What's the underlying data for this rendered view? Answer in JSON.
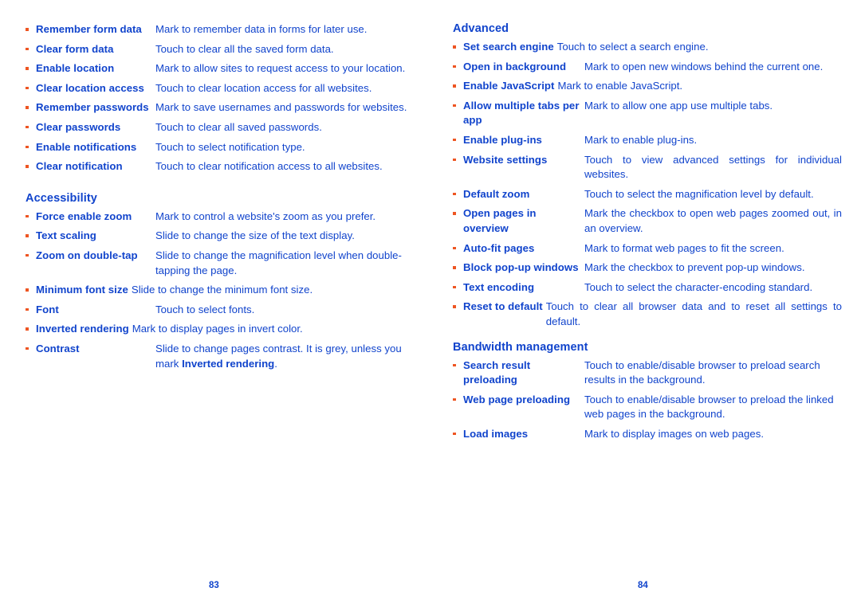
{
  "colors": {
    "text": "#1144cc",
    "bullet": "#ee5522",
    "background": "#ffffff"
  },
  "left_page": {
    "page_number": "83",
    "top_rows": [
      {
        "term": "Remember form data",
        "desc": "Mark to remember data in forms for later use."
      },
      {
        "term": "Clear form data",
        "desc": "Touch to clear all the saved form data."
      },
      {
        "term": "Enable location",
        "desc": "Mark to allow sites to request access to your location."
      },
      {
        "term": "Clear location access",
        "desc": "Touch to clear location access for all websites."
      },
      {
        "term": "Remember passwords",
        "desc": "Mark to save usernames and passwords for websites."
      },
      {
        "term": "Clear passwords",
        "desc": "Touch to clear all saved passwords."
      },
      {
        "term": "Enable notifications",
        "desc": "Touch to select notification type."
      },
      {
        "term": "Clear notification",
        "desc": "Touch to clear notification access to all websites."
      }
    ],
    "accessibility": {
      "heading": "Accessibility",
      "rows": [
        {
          "term": "Force enable zoom",
          "desc": "Mark to control a website's zoom as you prefer."
        },
        {
          "term": "Text scaling",
          "desc": "Slide to change the size of the text display."
        },
        {
          "term": "Zoom on double-tap",
          "desc": "Slide to change the magnification level when double-tapping the page."
        },
        {
          "term": "Minimum font size",
          "desc": "Slide to change the minimum font size."
        },
        {
          "term": "Font",
          "desc": "Touch to select fonts."
        },
        {
          "term": "Inverted rendering",
          "desc": "Mark to display pages in invert color."
        },
        {
          "term": "Contrast",
          "desc_prefix": "Slide to change pages contrast. It is grey, unless you mark ",
          "desc_bold": "Inverted rendering",
          "desc_suffix": "."
        }
      ]
    }
  },
  "right_page": {
    "page_number": "84",
    "advanced": {
      "heading": "Advanced",
      "rows": [
        {
          "term": "Set search engine",
          "desc": "Touch to select a search engine."
        },
        {
          "term": "Open in background",
          "desc": "Mark to open new windows behind the current one."
        },
        {
          "term": "Enable JavaScript",
          "desc": "Mark to enable JavaScript."
        },
        {
          "term": "Allow multiple tabs per app",
          "desc": "Mark to allow one app use multiple tabs."
        },
        {
          "term": "Enable plug-ins",
          "desc": "Mark to enable plug-ins."
        },
        {
          "term": "Website settings",
          "desc": "Touch to view advanced settings for individual websites."
        },
        {
          "term": "Default zoom",
          "desc": "Touch to select the magnification level by default."
        },
        {
          "term": "Open pages in overview",
          "desc": "Mark the checkbox to open web pages zoomed out, in an overview."
        },
        {
          "term": "Auto-fit pages",
          "desc": "Mark to format web pages to fit the screen."
        },
        {
          "term": "Block pop-up windows",
          "desc": "Mark the checkbox to prevent pop-up windows."
        },
        {
          "term": "Text encoding",
          "desc": "Touch to select the character-encoding standard."
        },
        {
          "term": "Reset to default",
          "desc": "Touch to clear all browser data and to reset all settings to default."
        }
      ]
    },
    "bandwidth": {
      "heading": "Bandwidth management",
      "rows": [
        {
          "term": "Search result preloading",
          "desc": "Touch to enable/disable browser to preload search results in the background."
        },
        {
          "term": "Web page preloading",
          "desc": "Touch to enable/disable browser to preload the linked web pages in the background."
        },
        {
          "term": "Load images",
          "desc": "Mark to display images on web pages."
        }
      ]
    }
  }
}
